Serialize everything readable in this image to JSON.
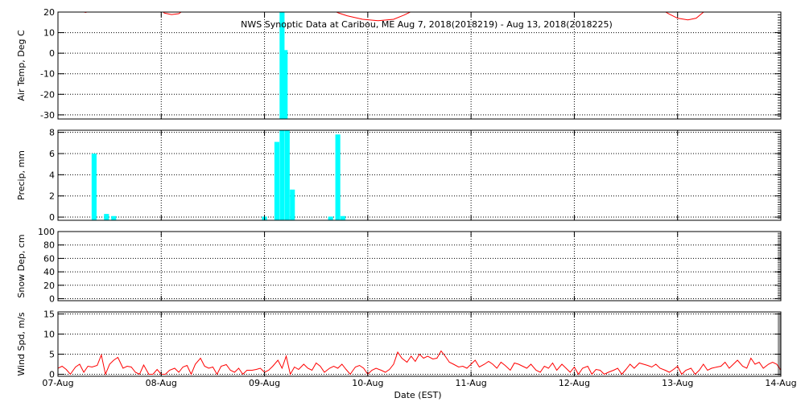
{
  "title": "NWS Synoptic Data at Caribou, ME   Aug  7, 2018(2018219) - Aug 13, 2018(2018225)",
  "colors": {
    "precip": "#00ffff",
    "temp": "#ff0000",
    "wind": "#ff0000",
    "axis": "#000000"
  },
  "chart_data": [
    {
      "type": "bar",
      "ylabel": "Air Temp, Deg C",
      "ylim": [
        -32,
        20
      ],
      "yticks": [
        -30,
        -20,
        -10,
        0,
        10,
        20
      ],
      "note_line_series": "temperature line mostly above the plotted range; visible only near top edge",
      "bars": [
        {
          "x": 2.17,
          "value": 20
        },
        {
          "x": 2.2,
          "value": 1.5
        }
      ],
      "temp_line": [
        {
          "x": 0.2,
          "value": 20.5
        },
        {
          "x": 0.27,
          "value": 19.8
        },
        {
          "x": 0.32,
          "value": 21
        },
        {
          "x": 1.0,
          "value": 21
        },
        {
          "x": 1.03,
          "value": 19.5
        },
        {
          "x": 1.1,
          "value": 18.8
        },
        {
          "x": 1.17,
          "value": 19.2
        },
        {
          "x": 1.22,
          "value": 21
        },
        {
          "x": 1.42,
          "value": 21
        },
        {
          "x": 1.45,
          "value": 20
        },
        {
          "x": 1.5,
          "value": 20.4
        },
        {
          "x": 1.54,
          "value": 21
        },
        {
          "x": 2.65,
          "value": 21
        },
        {
          "x": 2.72,
          "value": 19.5
        },
        {
          "x": 2.8,
          "value": 18.2
        },
        {
          "x": 2.95,
          "value": 16.5
        },
        {
          "x": 3.1,
          "value": 15.8
        },
        {
          "x": 3.25,
          "value": 16.5
        },
        {
          "x": 3.35,
          "value": 18.5
        },
        {
          "x": 3.42,
          "value": 20.2
        },
        {
          "x": 3.48,
          "value": 21
        },
        {
          "x": 5.85,
          "value": 21
        },
        {
          "x": 5.92,
          "value": 19.0
        },
        {
          "x": 6.0,
          "value": 17.0
        },
        {
          "x": 6.1,
          "value": 16.2
        },
        {
          "x": 6.18,
          "value": 17.0
        },
        {
          "x": 6.24,
          "value": 19.5
        },
        {
          "x": 6.28,
          "value": 21
        }
      ]
    },
    {
      "type": "bar",
      "ylabel": "Precip, mm",
      "ylim": [
        -0.3,
        8.2
      ],
      "yticks": [
        0,
        2,
        4,
        6,
        8
      ],
      "bars": [
        {
          "x": 0.35,
          "value": 6.0
        },
        {
          "x": 0.47,
          "value": 0.3
        },
        {
          "x": 0.54,
          "value": 0.1
        },
        {
          "x": 2.0,
          "value": 0.05
        },
        {
          "x": 2.12,
          "value": 7.1
        },
        {
          "x": 2.17,
          "value": 8.2
        },
        {
          "x": 2.22,
          "value": 8.2
        },
        {
          "x": 2.27,
          "value": 2.6
        },
        {
          "x": 2.64,
          "value": 0.05
        },
        {
          "x": 2.71,
          "value": 7.8
        },
        {
          "x": 2.76,
          "value": 0.1
        }
      ]
    },
    {
      "type": "line",
      "ylabel": "Snow Dep, cm",
      "ylim": [
        -3,
        100
      ],
      "yticks": [
        0,
        20,
        40,
        60,
        80,
        100
      ],
      "values": []
    },
    {
      "type": "line",
      "ylabel": "Wind Spd, m/s",
      "xlabel": "Date (EST)",
      "ylim": [
        -0.5,
        15.5
      ],
      "yticks": [
        0,
        5,
        10,
        15
      ],
      "xticks": [
        "07-Aug",
        "08-Aug",
        "09-Aug",
        "10-Aug",
        "11-Aug",
        "12-Aug",
        "13-Aug",
        "14-Aug"
      ],
      "x": [
        0.0,
        0.04,
        0.08,
        0.12,
        0.17,
        0.21,
        0.25,
        0.29,
        0.33,
        0.38,
        0.42,
        0.46,
        0.5,
        0.54,
        0.58,
        0.63,
        0.67,
        0.71,
        0.75,
        0.79,
        0.83,
        0.88,
        0.92,
        0.96,
        1.0,
        1.04,
        1.08,
        1.13,
        1.17,
        1.21,
        1.25,
        1.29,
        1.33,
        1.38,
        1.42,
        1.46,
        1.5,
        1.54,
        1.58,
        1.63,
        1.67,
        1.71,
        1.75,
        1.79,
        1.83,
        1.88,
        1.92,
        1.96,
        2.0,
        2.04,
        2.08,
        2.13,
        2.17,
        2.21,
        2.25,
        2.29,
        2.33,
        2.38,
        2.42,
        2.46,
        2.5,
        2.54,
        2.58,
        2.63,
        2.67,
        2.71,
        2.75,
        2.79,
        2.83,
        2.88,
        2.92,
        2.96,
        3.0,
        3.04,
        3.08,
        3.13,
        3.17,
        3.21,
        3.25,
        3.29,
        3.33,
        3.38,
        3.42,
        3.46,
        3.5,
        3.54,
        3.58,
        3.63,
        3.67,
        3.71,
        3.75,
        3.79,
        3.83,
        3.88,
        3.92,
        3.96,
        4.0,
        4.04,
        4.08,
        4.13,
        4.17,
        4.21,
        4.25,
        4.29,
        4.33,
        4.38,
        4.42,
        4.46,
        4.5,
        4.54,
        4.58,
        4.63,
        4.67,
        4.71,
        4.75,
        4.79,
        4.83,
        4.88,
        4.92,
        4.96,
        5.0,
        5.04,
        5.08,
        5.13,
        5.17,
        5.21,
        5.25,
        5.29,
        5.33,
        5.38,
        5.42,
        5.46,
        5.5,
        5.54,
        5.58,
        5.63,
        5.67,
        5.71,
        5.75,
        5.79,
        5.83,
        5.88,
        5.92,
        5.96,
        6.0,
        6.04,
        6.08,
        6.13,
        6.17,
        6.21,
        6.25,
        6.29,
        6.33,
        6.38,
        6.42,
        6.46,
        6.5,
        6.54,
        6.58,
        6.63,
        6.67,
        6.71,
        6.75,
        6.79,
        6.83,
        6.88,
        6.92,
        6.96,
        7.0
      ],
      "values": [
        1.5,
        2.0,
        1.2,
        0.0,
        1.8,
        2.5,
        0.5,
        2.0,
        1.8,
        2.2,
        4.8,
        0.0,
        2.5,
        3.5,
        4.2,
        1.5,
        2.0,
        1.8,
        0.5,
        0.0,
        2.3,
        0.0,
        0.0,
        1.2,
        0.0,
        0.0,
        1.0,
        1.5,
        0.5,
        1.8,
        2.2,
        0.0,
        2.5,
        4.0,
        2.0,
        1.5,
        1.8,
        0.0,
        2.0,
        2.4,
        1.0,
        0.5,
        1.5,
        0.0,
        1.0,
        1.0,
        1.2,
        1.5,
        0.5,
        1.0,
        2.0,
        3.5,
        1.5,
        4.5,
        0.0,
        1.8,
        1.2,
        2.5,
        1.5,
        1.0,
        2.8,
        2.0,
        0.5,
        1.5,
        2.0,
        1.5,
        2.5,
        1.2,
        0.0,
        1.8,
        2.2,
        1.5,
        0.0,
        1.0,
        1.5,
        1.0,
        0.5,
        1.2,
        2.5,
        5.5,
        4.0,
        3.0,
        4.5,
        3.2,
        5.0,
        4.0,
        4.5,
        3.8,
        4.0,
        5.8,
        4.5,
        3.0,
        2.5,
        1.8,
        2.0,
        1.5,
        2.5,
        3.5,
        1.8,
        2.5,
        3.2,
        2.5,
        1.5,
        3.0,
        2.2,
        1.0,
        2.8,
        2.5,
        2.0,
        1.5,
        2.5,
        1.0,
        0.5,
        2.0,
        1.5,
        2.8,
        1.0,
        2.5,
        1.5,
        0.5,
        1.8,
        0.0,
        1.5,
        2.0,
        0.0,
        1.2,
        1.0,
        0.0,
        0.5,
        1.0,
        1.5,
        0.0,
        1.2,
        2.5,
        1.5,
        2.8,
        2.5,
        2.2,
        1.8,
        2.5,
        1.5,
        1.0,
        0.5,
        1.2,
        2.0,
        0.0,
        1.0,
        1.5,
        0.0,
        1.0,
        2.5,
        1.0,
        1.5,
        1.8,
        2.0,
        3.0,
        1.5,
        2.5,
        3.5,
        2.0,
        1.5,
        4.0,
        2.5,
        3.0,
        1.5,
        2.5,
        3.0,
        2.5,
        1.0,
        0.0,
        1.5,
        2.0,
        1.5
      ]
    }
  ]
}
